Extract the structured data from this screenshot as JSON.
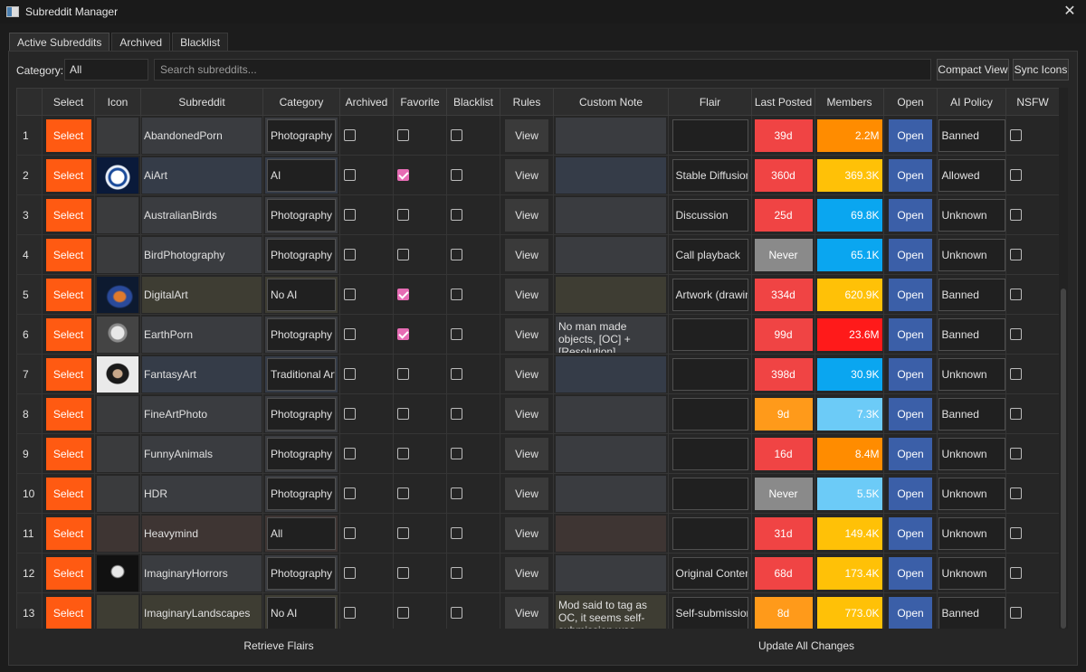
{
  "window": {
    "title": "Subreddit Manager",
    "app_icon": "window-app-icon",
    "close_icon": "close-icon"
  },
  "tabs": [
    {
      "label": "Active Subreddits",
      "active": true
    },
    {
      "label": "Archived",
      "active": false
    },
    {
      "label": "Blacklist",
      "active": false
    }
  ],
  "toolbar": {
    "category_label": "Category:",
    "category_value": "All",
    "search_placeholder": "Search subreddits...",
    "compact_view_label": "Compact View",
    "sync_icons_label": "Sync Icons"
  },
  "columns": [
    "Select",
    "Icon",
    "Subreddit",
    "Category",
    "Archived",
    "Favorite",
    "Blacklist",
    "Rules",
    "Custom Note",
    "Flair",
    "Last Posted",
    "Members",
    "Open",
    "AI Policy",
    "NSFW"
  ],
  "colors": {
    "select_button": "#ff5a12",
    "open_button": "#3b5fa8",
    "favorite_checked": "#e66cb4"
  },
  "rows": [
    {
      "num": "1",
      "select": "Select",
      "icon": "blank",
      "name": "AbandonedPorn",
      "name_bg": "#3a3c40",
      "category": "Photography",
      "archived": false,
      "favorite": false,
      "blacklist": false,
      "rules": "View",
      "note": "",
      "flair": "",
      "last_posted": "39d",
      "posted_color": "#f04444",
      "members": "2.2M",
      "members_color": "#ff8c00",
      "open": "Open",
      "ai_policy": "Banned",
      "nsfw": false
    },
    {
      "num": "2",
      "select": "Select",
      "icon": "ai-robot",
      "name": "AiArt",
      "name_bg": "#353c48",
      "category": "AI",
      "archived": false,
      "favorite": true,
      "blacklist": false,
      "rules": "View",
      "note": "",
      "flair": "Stable Diffusion",
      "last_posted": "360d",
      "posted_color": "#f04444",
      "members": "369.3K",
      "members_color": "#ffc107",
      "open": "Open",
      "ai_policy": "Allowed",
      "nsfw": false
    },
    {
      "num": "3",
      "select": "Select",
      "icon": "blank",
      "name": "AustralianBirds",
      "name_bg": "#3a3c40",
      "category": "Photography",
      "archived": false,
      "favorite": false,
      "blacklist": false,
      "rules": "View",
      "note": "",
      "flair": "Discussion",
      "last_posted": "25d",
      "posted_color": "#f04444",
      "members": "69.8K",
      "members_color": "#0aa6f0",
      "open": "Open",
      "ai_policy": "Unknown",
      "nsfw": false
    },
    {
      "num": "4",
      "select": "Select",
      "icon": "blank",
      "name": "BirdPhotography",
      "name_bg": "#3a3c40",
      "category": "Photography",
      "archived": false,
      "favorite": false,
      "blacklist": false,
      "rules": "View",
      "note": "",
      "flair": "Call playback",
      "last_posted": "Never",
      "posted_color": "#8a8a8a",
      "members": "65.1K",
      "members_color": "#0aa6f0",
      "open": "Open",
      "ai_policy": "Unknown",
      "nsfw": false
    },
    {
      "num": "5",
      "select": "Select",
      "icon": "digital-art",
      "name": "DigitalArt",
      "name_bg": "#3e3d33",
      "category": "No AI",
      "archived": false,
      "favorite": true,
      "blacklist": false,
      "rules": "View",
      "note": "",
      "flair": "Artwork (drawing)",
      "last_posted": "334d",
      "posted_color": "#f04444",
      "members": "620.9K",
      "members_color": "#ffc107",
      "open": "Open",
      "ai_policy": "Banned",
      "nsfw": false
    },
    {
      "num": "6",
      "select": "Select",
      "icon": "earth-alien",
      "name": "EarthPorn",
      "name_bg": "#3a3c40",
      "category": "Photography",
      "archived": false,
      "favorite": true,
      "blacklist": false,
      "rules": "View",
      "note": "No man made objects, [OC] + [Resolution]",
      "flair": "",
      "last_posted": "99d",
      "posted_color": "#f04444",
      "members": "23.6M",
      "members_color": "#ff1a1a",
      "open": "Open",
      "ai_policy": "Banned",
      "nsfw": false
    },
    {
      "num": "7",
      "select": "Select",
      "icon": "fantasy-portrait",
      "name": "FantasyArt",
      "name_bg": "#353c48",
      "category": "Traditional Art",
      "archived": false,
      "favorite": false,
      "blacklist": false,
      "rules": "View",
      "note": "",
      "flair": "",
      "last_posted": "398d",
      "posted_color": "#f04444",
      "members": "30.9K",
      "members_color": "#0aa6f0",
      "open": "Open",
      "ai_policy": "Unknown",
      "nsfw": false
    },
    {
      "num": "8",
      "select": "Select",
      "icon": "blank",
      "name": "FineArtPhoto",
      "name_bg": "#3a3c40",
      "category": "Photography",
      "archived": false,
      "favorite": false,
      "blacklist": false,
      "rules": "View",
      "note": "",
      "flair": "",
      "last_posted": "9d",
      "posted_color": "#ff9a1a",
      "members": "7.3K",
      "members_color": "#6ccbf7",
      "open": "Open",
      "ai_policy": "Banned",
      "nsfw": false
    },
    {
      "num": "9",
      "select": "Select",
      "icon": "blank",
      "name": "FunnyAnimals",
      "name_bg": "#3a3c40",
      "category": "Photography",
      "archived": false,
      "favorite": false,
      "blacklist": false,
      "rules": "View",
      "note": "",
      "flair": "",
      "last_posted": "16d",
      "posted_color": "#f04444",
      "members": "8.4M",
      "members_color": "#ff8c00",
      "open": "Open",
      "ai_policy": "Unknown",
      "nsfw": false
    },
    {
      "num": "10",
      "select": "Select",
      "icon": "blank",
      "name": "HDR",
      "name_bg": "#3a3c40",
      "category": "Photography",
      "archived": false,
      "favorite": false,
      "blacklist": false,
      "rules": "View",
      "note": "",
      "flair": "",
      "last_posted": "Never",
      "posted_color": "#8a8a8a",
      "members": "5.5K",
      "members_color": "#6ccbf7",
      "open": "Open",
      "ai_policy": "Unknown",
      "nsfw": false
    },
    {
      "num": "11",
      "select": "Select",
      "icon": "blank-brown",
      "name": "Heavymind",
      "name_bg": "#3e3533",
      "category": "All",
      "archived": false,
      "favorite": false,
      "blacklist": false,
      "rules": "View",
      "note": "",
      "flair": "",
      "last_posted": "31d",
      "posted_color": "#f04444",
      "members": "149.4K",
      "members_color": "#ffc107",
      "open": "Open",
      "ai_policy": "Unknown",
      "nsfw": false
    },
    {
      "num": "12",
      "select": "Select",
      "icon": "horror-mask",
      "name": "ImaginaryHorrors",
      "name_bg": "#3a3c40",
      "category": "Photography",
      "archived": false,
      "favorite": false,
      "blacklist": false,
      "rules": "View",
      "note": "",
      "flair": "Original Content",
      "last_posted": "68d",
      "posted_color": "#f04444",
      "members": "173.4K",
      "members_color": "#ffc107",
      "open": "Open",
      "ai_policy": "Unknown",
      "nsfw": false
    },
    {
      "num": "13",
      "select": "Select",
      "icon": "blank-olive",
      "name": "ImaginaryLandscapes",
      "name_bg": "#3e3d33",
      "category": "No AI",
      "archived": false,
      "favorite": false,
      "blacklist": false,
      "rules": "View",
      "note": "Mod said to tag as OC, it seems self-submission was selected here ...",
      "flair": "Self-submission",
      "last_posted": "8d",
      "posted_color": "#ff9a1a",
      "members": "773.0K",
      "members_color": "#ffc107",
      "open": "Open",
      "ai_policy": "Banned",
      "nsfw": false
    }
  ],
  "footer": {
    "retrieve_flairs_label": "Retrieve Flairs",
    "update_all_label": "Update All Changes"
  }
}
